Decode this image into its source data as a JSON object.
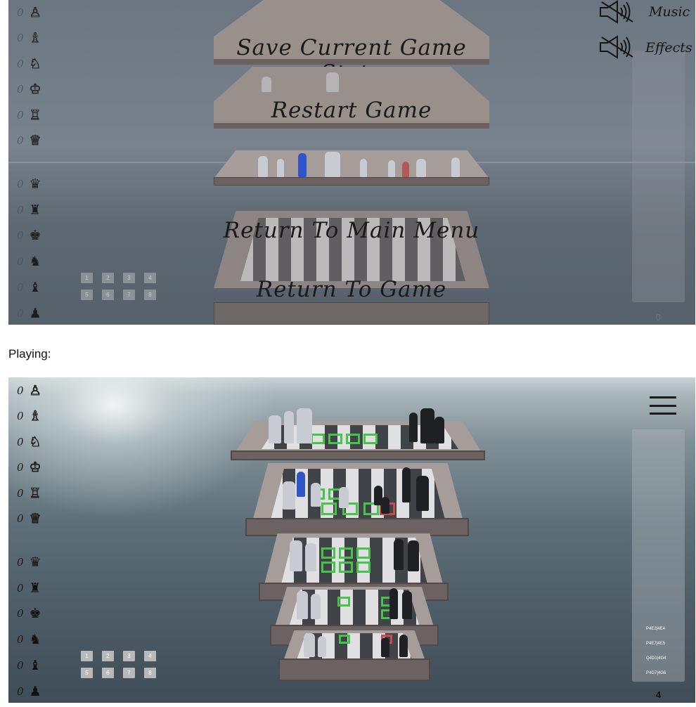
{
  "paused": {
    "menu": [
      {
        "label": "Save Current Game State"
      },
      {
        "label": "Restart Game"
      },
      {
        "label": "Return To Main Menu"
      },
      {
        "label": "Return To Game"
      }
    ],
    "audio": {
      "music_label": "Music",
      "effects_label": "Effects",
      "music_icon": "speaker-muted-icon",
      "effects_icon": "speaker-muted-icon"
    },
    "move_count": "0"
  },
  "caption": "Playing:",
  "playing": {
    "move_history": [
      "P4E2|4E4",
      "P4E7|4E5",
      "Q4D1|4G4",
      "P4G7|4G6"
    ],
    "move_count": "4",
    "menu_icon": "hamburger-icon"
  },
  "captured": {
    "white": [
      {
        "count": "0",
        "piece": "pawn",
        "glyph": "♙"
      },
      {
        "count": "0",
        "piece": "bishop",
        "glyph": "♗"
      },
      {
        "count": "0",
        "piece": "knight",
        "glyph": "♘"
      },
      {
        "count": "0",
        "piece": "king",
        "glyph": "♔"
      },
      {
        "count": "0",
        "piece": "rook",
        "glyph": "♖"
      },
      {
        "count": "0",
        "piece": "queen",
        "glyph": "♕"
      }
    ],
    "black": [
      {
        "count": "0",
        "piece": "queen",
        "glyph": "♛"
      },
      {
        "count": "0",
        "piece": "rook",
        "glyph": "♜"
      },
      {
        "count": "0",
        "piece": "king",
        "glyph": "♚"
      },
      {
        "count": "0",
        "piece": "knight",
        "glyph": "♞"
      },
      {
        "count": "0",
        "piece": "bishop",
        "glyph": "♝"
      },
      {
        "count": "0",
        "piece": "pawn",
        "glyph": "♟"
      }
    ]
  },
  "layer_buttons": [
    "1",
    "2",
    "3",
    "4",
    "5",
    "6",
    "7",
    "8"
  ],
  "colors": {
    "highlight": "#45c44a",
    "selected_piece": "#2f56c8",
    "threat_square": "#c84a4a",
    "tier_frame": "#6b6261"
  }
}
